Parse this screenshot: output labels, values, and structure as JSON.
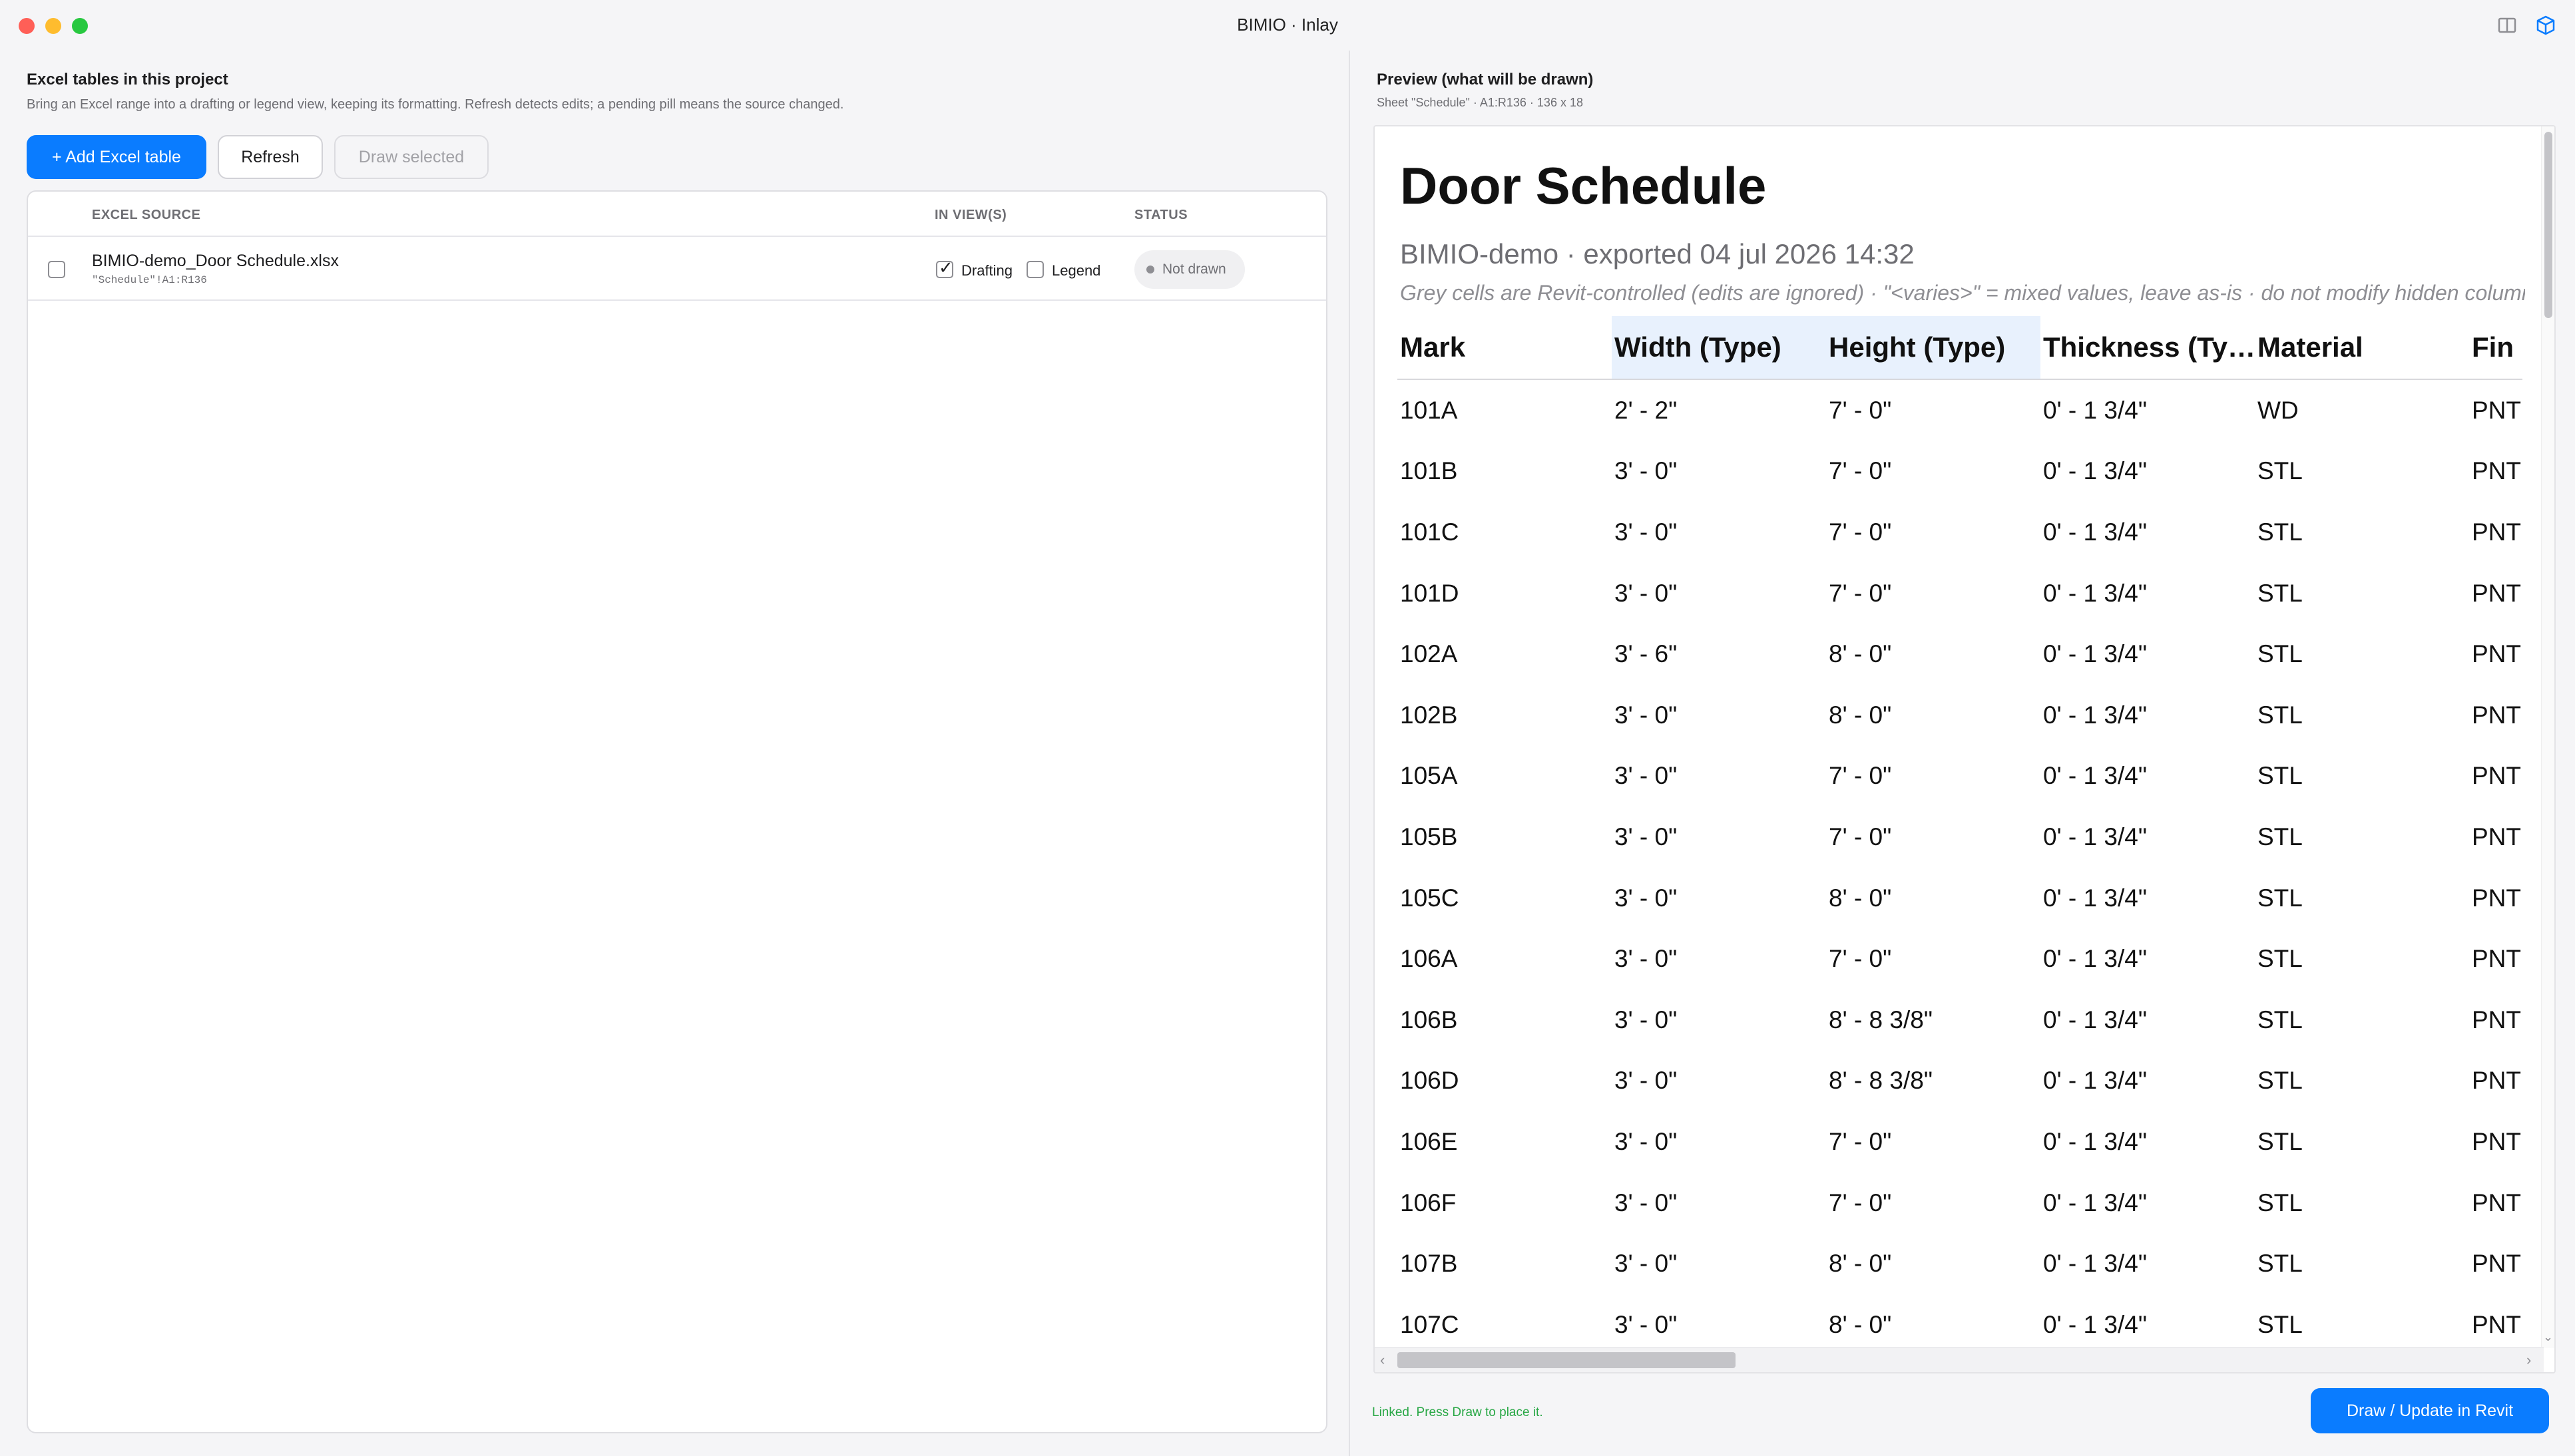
{
  "window": {
    "title": "BIMIO · Inlay"
  },
  "left": {
    "title": "Excel tables in this project",
    "subtitle": "Bring an Excel range into a drafting or legend view, keeping its formatting. Refresh detects edits; a pending pill means the source changed.",
    "buttons": {
      "add": "+ Add Excel table",
      "refresh": "Refresh",
      "draw_selected": "Draw selected"
    },
    "table": {
      "headers": [
        "EXCEL SOURCE",
        "IN VIEW(S)",
        "STATUS"
      ],
      "rows": [
        {
          "name": "BIMIO-demo_Door Schedule.xlsx",
          "range": "\"Schedule\"!A1:R136",
          "selected": false,
          "views": [
            {
              "label": "Drafting",
              "checked": true
            },
            {
              "label": "Legend",
              "checked": false
            }
          ],
          "status": "Not drawn"
        }
      ]
    }
  },
  "preview": {
    "title": "Preview (what will be drawn)",
    "subtitle": "Sheet \"Schedule\" · A1:R136 · 136 x 18",
    "doc_title": "Door Schedule",
    "doc_subtitle": "BIMIO-demo · exported 04 jul 2026 14:32",
    "doc_note": "Grey cells are Revit-controlled (edits are ignored) · \"<varies>\" = mixed values, leave as-is · do not modify hidden columns",
    "columns": [
      "Mark",
      "Width  (Type)",
      "Height  (Type)",
      "Thickness  (Ty…",
      "Material",
      "Fin"
    ],
    "highlight_columns": [
      1,
      2
    ],
    "rows": [
      [
        "101A",
        "2' - 2\"",
        "7' - 0\"",
        "0' - 1 3/4\"",
        "WD",
        "PNT"
      ],
      [
        "101B",
        "3' - 0\"",
        "7' - 0\"",
        "0' - 1 3/4\"",
        "STL",
        "PNT"
      ],
      [
        "101C",
        "3' - 0\"",
        "7' - 0\"",
        "0' - 1 3/4\"",
        "STL",
        "PNT"
      ],
      [
        "101D",
        "3' - 0\"",
        "7' - 0\"",
        "0' - 1 3/4\"",
        "STL",
        "PNT"
      ],
      [
        "102A",
        "3' - 6\"",
        "8' - 0\"",
        "0' - 1 3/4\"",
        "STL",
        "PNT"
      ],
      [
        "102B",
        "3' - 0\"",
        "8' - 0\"",
        "0' - 1 3/4\"",
        "STL",
        "PNT"
      ],
      [
        "105A",
        "3' - 0\"",
        "7' - 0\"",
        "0' - 1 3/4\"",
        "STL",
        "PNT"
      ],
      [
        "105B",
        "3' - 0\"",
        "7' - 0\"",
        "0' - 1 3/4\"",
        "STL",
        "PNT"
      ],
      [
        "105C",
        "3' - 0\"",
        "8' - 0\"",
        "0' - 1 3/4\"",
        "STL",
        "PNT"
      ],
      [
        "106A",
        "3' - 0\"",
        "7' - 0\"",
        "0' - 1 3/4\"",
        "STL",
        "PNT"
      ],
      [
        "106B",
        "3' - 0\"",
        "8' - 8 3/8\"",
        "0' - 1 3/4\"",
        "STL",
        "PNT"
      ],
      [
        "106D",
        "3' - 0\"",
        "8' - 8 3/8\"",
        "0' - 1 3/4\"",
        "STL",
        "PNT"
      ],
      [
        "106E",
        "3' - 0\"",
        "7' - 0\"",
        "0' - 1 3/4\"",
        "STL",
        "PNT"
      ],
      [
        "106F",
        "3' - 0\"",
        "7' - 0\"",
        "0' - 1 3/4\"",
        "STL",
        "PNT"
      ],
      [
        "107B",
        "3' - 0\"",
        "8' - 0\"",
        "0' - 1 3/4\"",
        "STL",
        "PNT"
      ],
      [
        "107C",
        "3' - 0\"",
        "8' - 0\"",
        "0' - 1 3/4\"",
        "STL",
        "PNT"
      ]
    ],
    "linked_text": "Linked. Press Draw to place it.",
    "draw_button": "Draw / Update in Revit"
  },
  "colors": {
    "accent": "#0a7cff",
    "linked": "#28a745",
    "header_highlight": "#e8f1fd"
  }
}
